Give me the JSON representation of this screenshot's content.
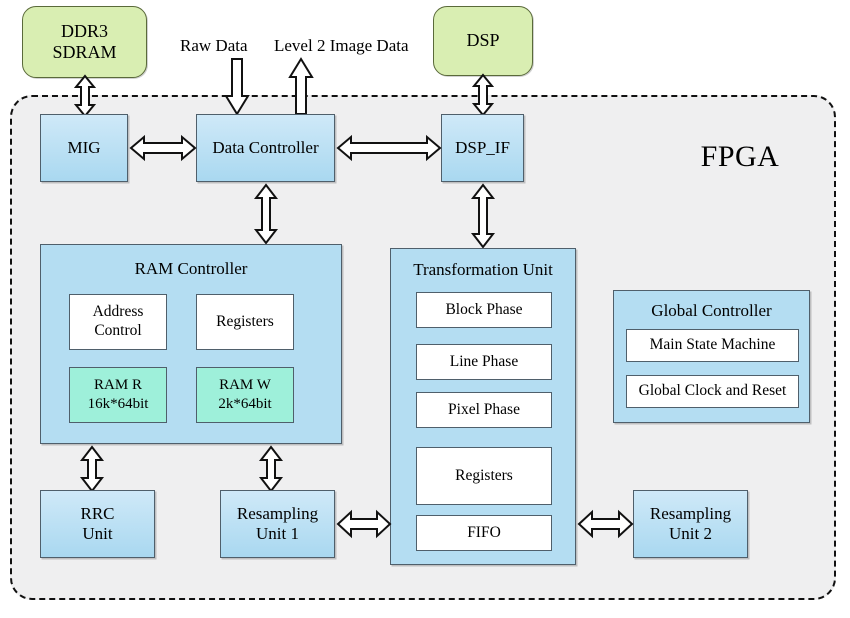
{
  "diagram": {
    "title": "FPGA SAR imaging processor block diagram",
    "chip_label": "FPGA",
    "colors": {
      "external_block": "#d9eeb2",
      "module": "#b4ddf2",
      "ram_block": "#9ef0da",
      "sub_block": "#ffffff",
      "chip_background": "#efeff0",
      "outline": "#4f5f6b",
      "border": "#111111"
    }
  },
  "external": {
    "ddr3": "DDR3\nSDRAM",
    "ddr3_line1": "DDR3",
    "ddr3_line2": "SDRAM",
    "dsp": "DSP"
  },
  "captions": {
    "raw_data": "Raw Data",
    "level2_image_data": "Level 2 Image Data"
  },
  "top_row": {
    "mig": "MIG",
    "data_controller": "Data Controller",
    "dsp_if": "DSP_IF"
  },
  "ram_controller": {
    "title": "RAM Controller",
    "blocks": [
      {
        "label_line1": "Address",
        "label_line2": "Control"
      },
      {
        "label_line1": "Registers",
        "label_line2": ""
      }
    ],
    "rams": [
      {
        "name": "RAM R",
        "size": "16k*64bit"
      },
      {
        "name": "RAM W",
        "size": "2k*64bit"
      }
    ]
  },
  "transformation_unit": {
    "title": "Transformation Unit",
    "blocks": [
      "Block  Phase",
      "Line Phase",
      "Pixel Phase",
      "Registers",
      "FIFO"
    ]
  },
  "global_controller": {
    "title": "Global Controller",
    "blocks": [
      "Main State Machine",
      "Global Clock and Reset"
    ]
  },
  "bottom_row": {
    "rrc_unit_line1": "RRC",
    "rrc_unit_line2": "Unit",
    "resampling_unit_1_line1": "Resampling",
    "resampling_unit_1_line2": "Unit 1",
    "resampling_unit_2_line1": "Resampling",
    "resampling_unit_2_line2": "Unit 2"
  },
  "connections": [
    {
      "from": "DDR3 SDRAM",
      "to": "MIG",
      "type": "bidirectional-vertical"
    },
    {
      "from": "DSP",
      "to": "DSP_IF",
      "type": "bidirectional-vertical"
    },
    {
      "from": "Raw Data",
      "to": "Data Controller",
      "type": "down"
    },
    {
      "from": "Data Controller",
      "to": "Level 2 Image Data",
      "type": "up"
    },
    {
      "from": "MIG",
      "to": "Data Controller",
      "type": "bidirectional-horizontal"
    },
    {
      "from": "Data Controller",
      "to": "DSP_IF",
      "type": "bidirectional-horizontal"
    },
    {
      "from": "Data Controller",
      "to": "RAM Controller",
      "type": "bidirectional-vertical"
    },
    {
      "from": "DSP_IF",
      "to": "Transformation Unit",
      "type": "bidirectional-vertical"
    },
    {
      "from": "RAM Controller",
      "to": "RRC Unit",
      "type": "bidirectional-vertical"
    },
    {
      "from": "RAM Controller",
      "to": "Resampling Unit 1",
      "type": "bidirectional-vertical"
    },
    {
      "from": "Resampling Unit 1",
      "to": "Transformation Unit",
      "type": "bidirectional-horizontal"
    },
    {
      "from": "Transformation Unit",
      "to": "Resampling Unit 2",
      "type": "bidirectional-horizontal"
    }
  ]
}
